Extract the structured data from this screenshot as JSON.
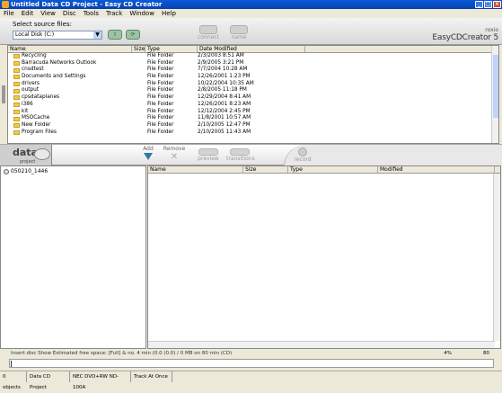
{
  "window": {
    "title": "Untitled Data CD Project - Easy CD Creator"
  },
  "menu": [
    "File",
    "Edit",
    "View",
    "Disc",
    "Tools",
    "Track",
    "Window",
    "Help"
  ],
  "source": {
    "label": "Select source files:",
    "drive": "Local Disk (C:)"
  },
  "toolbar": {
    "connect": "connect",
    "name": "name"
  },
  "brand": {
    "roxio": "roxio",
    "name": "EasyCDCreator 5"
  },
  "filelist": {
    "columns": [
      "Name",
      "Size",
      "Type",
      "Date Modified"
    ],
    "rows": [
      {
        "name": "Recycling",
        "size": "",
        "type": "File Folder",
        "date": "2/3/2003 8:51 AM"
      },
      {
        "name": "Barracuda Networks Outlook",
        "size": "",
        "type": "File Folder",
        "date": "2/9/2005 3:21 PM"
      },
      {
        "name": "cnsdtest",
        "size": "",
        "type": "File Folder",
        "date": "7/7/2004 10:28 AM"
      },
      {
        "name": "Documents and Settings",
        "size": "",
        "type": "File Folder",
        "date": "12/26/2001 1:23 PM"
      },
      {
        "name": "drivers",
        "size": "",
        "type": "File Folder",
        "date": "10/22/2004 10:35 AM"
      },
      {
        "name": "output",
        "size": "",
        "type": "File Folder",
        "date": "2/8/2005 11:18 PM"
      },
      {
        "name": "cpsdataplanes",
        "size": "",
        "type": "File Folder",
        "date": "12/29/2004 8:41 AM"
      },
      {
        "name": "i386",
        "size": "",
        "type": "File Folder",
        "date": "12/26/2001 8:23 AM"
      },
      {
        "name": "kit",
        "size": "",
        "type": "File Folder",
        "date": "12/12/2004 2:45 PM"
      },
      {
        "name": "MSOCache",
        "size": "",
        "type": "File Folder",
        "date": "11/8/2001 10:57 AM"
      },
      {
        "name": "New Folder",
        "size": "",
        "type": "File Folder",
        "date": "2/10/2005 12:47 PM"
      },
      {
        "name": "Program Files",
        "size": "",
        "type": "File Folder",
        "date": "2/10/2005 11:43 AM"
      }
    ]
  },
  "project": {
    "title": "data",
    "subtitle": "project",
    "add": "Add",
    "remove": "Remove",
    "preview": "preview",
    "transitions": "transitions",
    "record": "record"
  },
  "tree": {
    "item": "050210_1446"
  },
  "project_list": {
    "columns": [
      "Name",
      "Size",
      "Type",
      "Modified"
    ]
  },
  "capacity": {
    "text": "Insert disc Show Estimated free space: [Full] & no. 4 min (0.0 (0.0) / 0 MB on 80 min (CD)",
    "mid": "4%",
    "right": "80",
    "used_fraction": 0.0
  },
  "status": [
    "0 objects",
    "Data CD Project",
    "NEC DVD+RW ND-100A",
    "Track At Once"
  ]
}
